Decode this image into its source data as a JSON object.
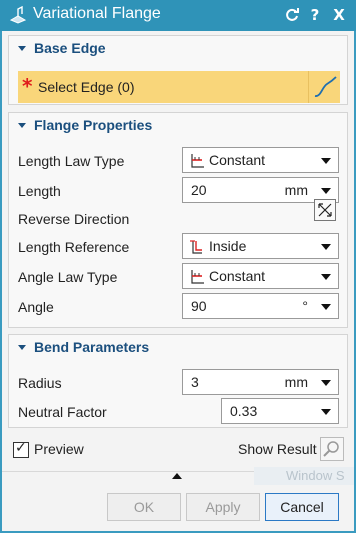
{
  "window": {
    "title": "Variational Flange",
    "icon": "flange-icon",
    "controls": [
      "reset-icon",
      "help-icon",
      "close-icon"
    ],
    "help_label": "?",
    "close_label": "X"
  },
  "base_edge": {
    "title": "Base Edge",
    "required_marker": "*",
    "select_label": "Select Edge (0)",
    "highlight_color": "#f9d67a"
  },
  "flange_properties": {
    "title": "Flange Properties",
    "length_law_type": {
      "label": "Length Law Type",
      "value": "Constant"
    },
    "length": {
      "label": "Length",
      "value": "20",
      "unit": "mm"
    },
    "reverse_direction": {
      "label": "Reverse Direction"
    },
    "length_reference": {
      "label": "Length Reference",
      "value": "Inside"
    },
    "angle_law_type": {
      "label": "Angle Law Type",
      "value": "Constant"
    },
    "angle": {
      "label": "Angle",
      "value": "90",
      "unit": "°"
    }
  },
  "bend_parameters": {
    "title": "Bend Parameters",
    "radius": {
      "label": "Radius",
      "value": "3",
      "unit": "mm"
    },
    "neutral_factor": {
      "label": "Neutral Factor",
      "value": "0.33"
    }
  },
  "preview": {
    "checkbox_label": "Preview",
    "checked": true,
    "check_mark": "✓",
    "show_result_label": "Show Result"
  },
  "background_hint": "Window S",
  "buttons": {
    "ok": "OK",
    "apply": "Apply",
    "cancel": "Cancel"
  },
  "colors": {
    "title_bar": "#2f93b8",
    "group_title": "#1b4f7e",
    "required": "#e01b1b",
    "focus_border": "#2b79c5"
  }
}
